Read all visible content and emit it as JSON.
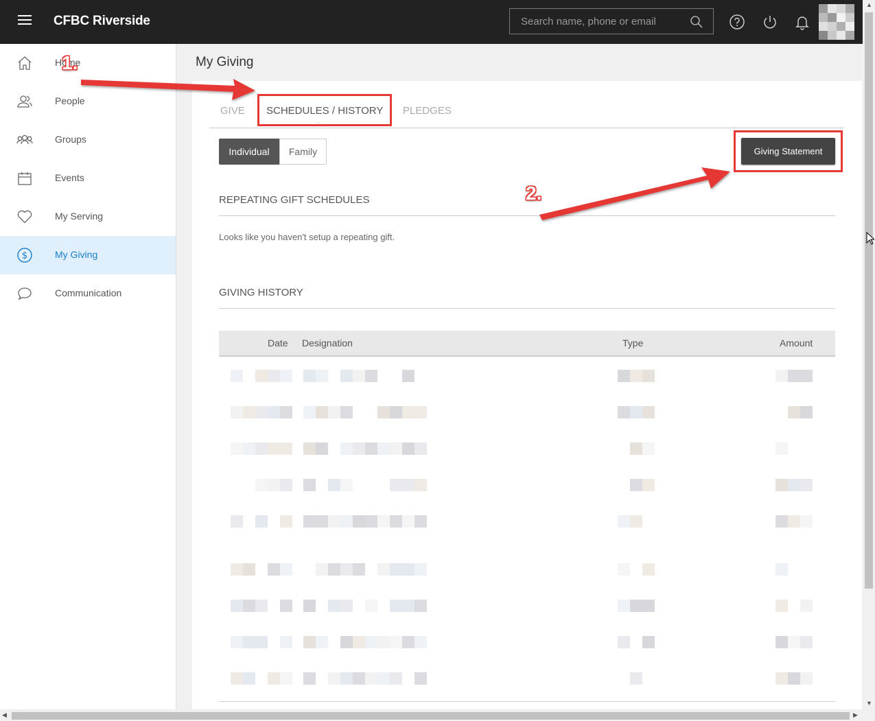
{
  "header": {
    "app_title": "CFBC Riverside",
    "search_placeholder": "Search name, phone or email",
    "icons": [
      "menu-icon",
      "search-icon",
      "help-icon",
      "power-icon",
      "bell-icon",
      "avatar"
    ]
  },
  "sidebar": {
    "items": [
      {
        "label": "Home",
        "icon": "home-icon",
        "active": false
      },
      {
        "label": "People",
        "icon": "people-icon",
        "active": false
      },
      {
        "label": "Groups",
        "icon": "groups-icon",
        "active": false
      },
      {
        "label": "Events",
        "icon": "calendar-icon",
        "active": false
      },
      {
        "label": "My Serving",
        "icon": "heart-icon",
        "active": false
      },
      {
        "label": "My Giving",
        "icon": "dollar-icon",
        "active": true
      },
      {
        "label": "Communication",
        "icon": "chat-icon",
        "active": false
      }
    ]
  },
  "main": {
    "page_title": "My Giving",
    "tabs": [
      {
        "label": "GIVE",
        "active": false
      },
      {
        "label": "SCHEDULES / HISTORY",
        "active": true
      },
      {
        "label": "PLEDGES",
        "active": false
      }
    ],
    "toggle": {
      "individual": "Individual",
      "family": "Family",
      "selected": "Individual"
    },
    "giving_statement_button": "Giving Statement",
    "repeating": {
      "heading": "REPEATING GIFT SCHEDULES",
      "empty_message": "Looks like you haven't setup a repeating gift."
    },
    "history": {
      "heading": "GIVING HISTORY",
      "columns": [
        "Date",
        "Designation",
        "Type",
        "Amount"
      ],
      "rows_redacted": 9
    }
  },
  "annotations": {
    "step1": "1.",
    "step2": "2."
  },
  "colors": {
    "topbar": "#222222",
    "active_nav_bg": "#dff0fc",
    "active_nav_text": "#1a7dc8",
    "annotation_red": "#e53935",
    "button_dark": "#444444"
  }
}
